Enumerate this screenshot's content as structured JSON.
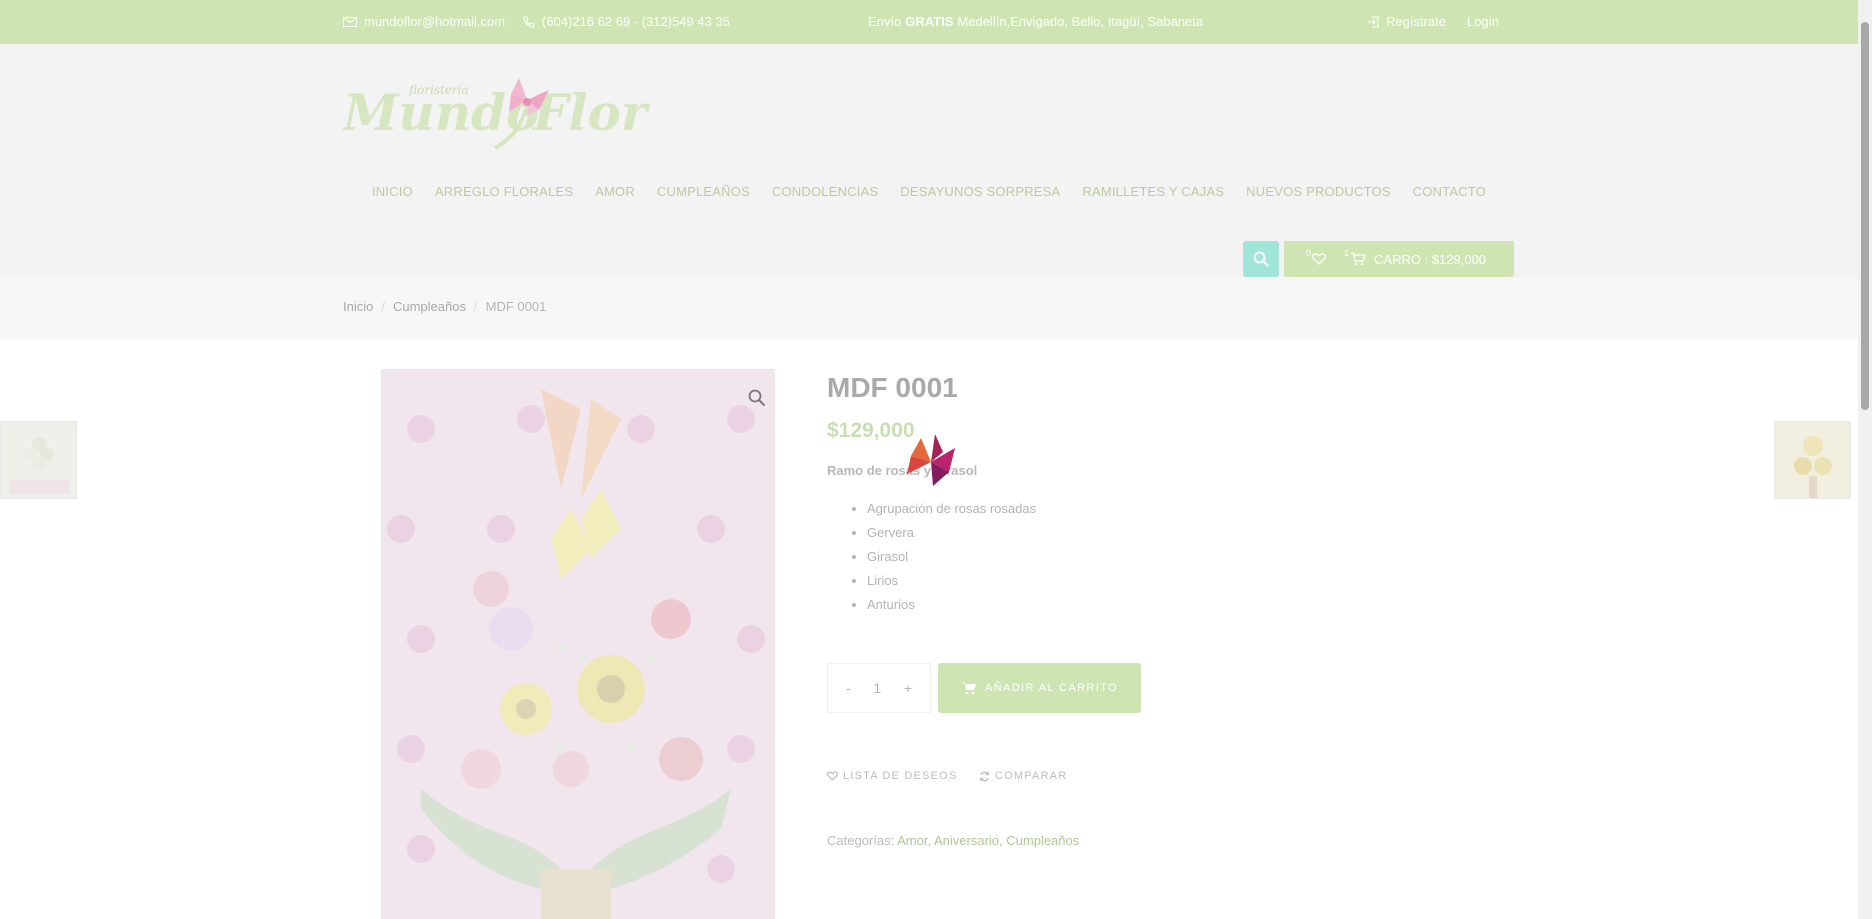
{
  "topbar": {
    "email": "mundoflor@hotmail.com",
    "phone": "(604)216 62 69 - (312)549 43 35",
    "shipping_prefix": "Envío",
    "shipping_bold": "GRATIS",
    "shipping_suffix": "Medellín,Envigado, Bello, Itagüí, Sabaneta",
    "register": "Regístrate",
    "login": "Login"
  },
  "logo": {
    "small": "floristeria",
    "main": "Mundo",
    "main2": "Flor"
  },
  "nav": [
    "INICIO",
    "ARREGLO FLORALES",
    "AMOR",
    "CUMPLEAÑOS",
    "CONDOLENCIAS",
    "DESAYUNOS SORPRESA",
    "RAMILLETES Y CAJAS",
    "NUEVOS PRODUCTOS",
    "CONTACTO"
  ],
  "header_actions": {
    "wishlist_count": "0",
    "cart_count": "1",
    "cart_label": "CARRO : $129,000"
  },
  "breadcrumb": [
    "Inicio",
    "Cumpleaños",
    "MDF 0001"
  ],
  "product": {
    "title": "MDF 0001",
    "price": "$129,000",
    "description": "Ramo de rosas y girasol",
    "features": [
      "Agrupación de rosas rosadas",
      "Gervera",
      "Girasol",
      "Lirios",
      "Anturios"
    ],
    "quantity": "1",
    "minus": "-",
    "plus": "+",
    "add_to_cart": "AÑADIR AL CARRITO",
    "wishlist": "LISTA DE DESEOS",
    "compare": "COMPARAR",
    "categories_label": "Categorías:",
    "categories": [
      "Amor",
      "Aniversario",
      "Cumpleaños"
    ]
  },
  "colors": {
    "accent_green": "#cfe4b3",
    "search_teal": "#a0e4da"
  }
}
